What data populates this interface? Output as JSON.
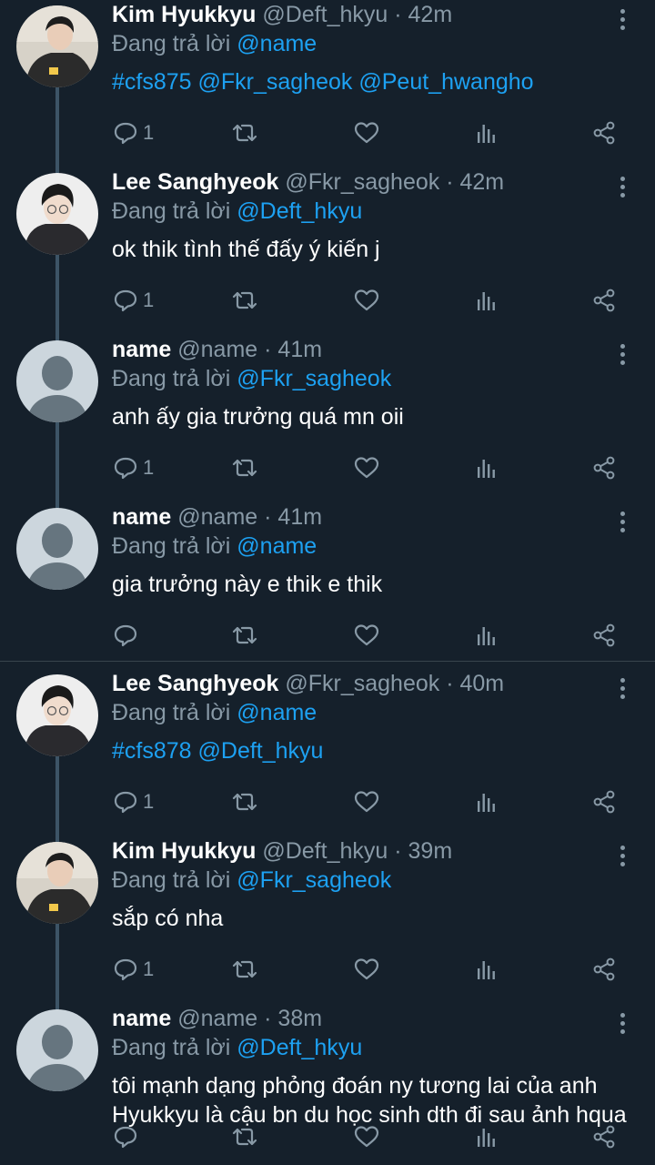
{
  "reply_prefix": "Đang trả lời",
  "colors": {
    "background": "#15202b",
    "accent": "#1da1f2",
    "muted": "#8899a6"
  },
  "tweets": [
    {
      "name": "Kim Hyukkyu",
      "handle": "@Deft_hkyu",
      "time": "· 42m",
      "reply_to": "@name",
      "body_parts": [
        {
          "text": "#cfs875",
          "link": true
        },
        {
          "text": " ",
          "link": false
        },
        {
          "text": "@Fkr_sagheok",
          "link": true
        },
        {
          "text": " ",
          "link": false
        },
        {
          "text": "@Peut_hwangho",
          "link": true
        }
      ],
      "reply_count": "1",
      "avatar": "kim-hyukkyu-avatar"
    },
    {
      "name": "Lee Sanghyeok",
      "handle": "@Fkr_sagheok",
      "time": "· 42m",
      "reply_to": "@Deft_hkyu",
      "body_parts": [
        {
          "text": "ok thik tình thế đấy ý kiến j",
          "link": false
        }
      ],
      "reply_count": "1",
      "avatar": "lee-sanghyeok-avatar"
    },
    {
      "name": "name",
      "handle": "@name",
      "time": "· 41m",
      "reply_to": "@Fkr_sagheok",
      "body_parts": [
        {
          "text": "anh ấy gia trưởng quá mn oii",
          "link": false
        }
      ],
      "reply_count": "1",
      "avatar": "default-avatar"
    },
    {
      "name": "name",
      "handle": "@name",
      "time": "· 41m",
      "reply_to": "@name",
      "body_parts": [
        {
          "text": "gia trưởng này e thik e thik",
          "link": false
        }
      ],
      "reply_count": "",
      "avatar": "default-avatar"
    },
    {
      "name": "Lee Sanghyeok",
      "handle": "@Fkr_sagheok",
      "time": "· 40m",
      "reply_to": "@name",
      "body_parts": [
        {
          "text": "#cfs878",
          "link": true
        },
        {
          "text": " ",
          "link": false
        },
        {
          "text": "@Deft_hkyu",
          "link": true
        }
      ],
      "reply_count": "1",
      "avatar": "lee-sanghyeok-avatar"
    },
    {
      "name": "Kim Hyukkyu",
      "handle": "@Deft_hkyu",
      "time": "· 39m",
      "reply_to": "@Fkr_sagheok",
      "body_parts": [
        {
          "text": "sắp có nha",
          "link": false
        }
      ],
      "reply_count": "1",
      "avatar": "kim-hyukkyu-avatar"
    },
    {
      "name": "name",
      "handle": "@name",
      "time": "· 38m",
      "reply_to": "@Deft_hkyu",
      "body_parts": [
        {
          "text": "tôi mạnh dạng phỏng đoán ny tương lai của anh Hyukkyu là cậu bn du học sinh dth đi sau ảnh hqua",
          "link": false
        }
      ],
      "reply_count": "",
      "avatar": "default-avatar"
    }
  ]
}
